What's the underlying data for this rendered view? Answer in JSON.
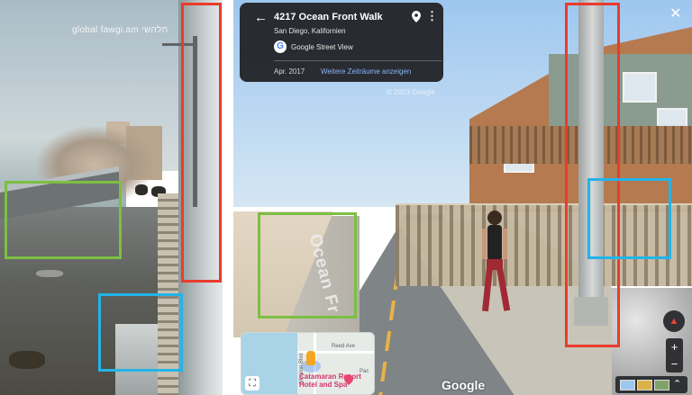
{
  "left_panel": {
    "watermark": "global fawgi.am חלהשי"
  },
  "street_view": {
    "card": {
      "back_icon": "arrow-left-icon",
      "title": "4217 Ocean Front Walk",
      "subtitle": "San Diego, Kalifornien",
      "brand": "Google Street View",
      "date": "Apr. 2017",
      "timeline_link": "Weitere Zeiträume anzeigen"
    },
    "copyright": "© 2023 Google",
    "painted_text": "Ocean Fr",
    "google_mark": "Google",
    "close_icon": "close-icon",
    "minimap": {
      "street_label": "Reed Ave",
      "blvd_label": "Mission Blvd",
      "place_label": "Catamaran Resort Hotel and Spa",
      "pac_label": "Pac"
    },
    "controls": {
      "zoom_in": "+",
      "zoom_out": "−"
    }
  },
  "annotation_colors": {
    "red": "#ea3b2c",
    "green": "#7cbf42",
    "blue": "#22b4e8"
  }
}
